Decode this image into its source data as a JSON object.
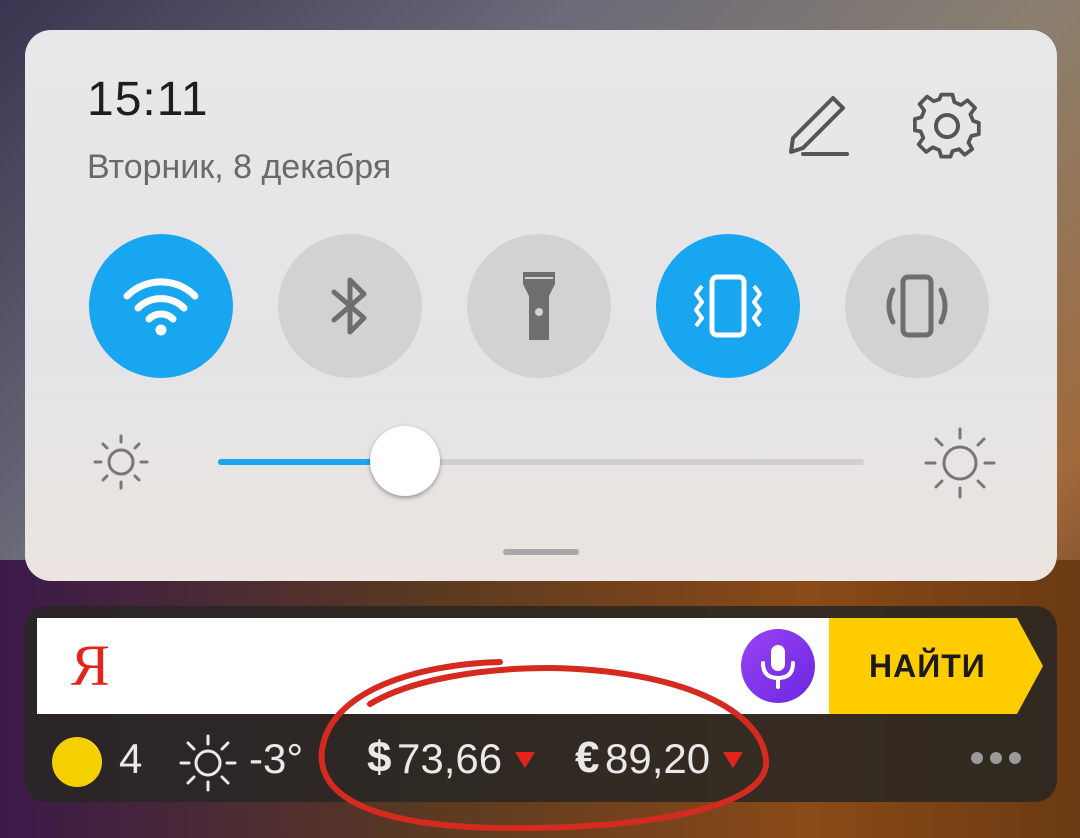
{
  "quick_settings": {
    "time": "15:11",
    "date": "Вторник, 8 декабря",
    "toggles": [
      {
        "icon": "wifi-icon",
        "state": "on"
      },
      {
        "icon": "bluetooth-icon",
        "state": "off"
      },
      {
        "icon": "flashlight-icon",
        "state": "off"
      },
      {
        "icon": "vibrate-icon",
        "state": "on"
      },
      {
        "icon": "auto-rotate-icon",
        "state": "off"
      }
    ],
    "brightness_fraction": 0.29,
    "accent_color": "#18a6f0"
  },
  "yandex_widget": {
    "logo": "Я",
    "search_placeholder": "",
    "find_button": "НАЙТИ",
    "traffic_score": "4",
    "temperature": "-3°",
    "usd_symbol": "$",
    "usd_rate": "73,66",
    "eur_symbol": "€",
    "eur_rate": "89,20",
    "brand_colors": {
      "logo": "#e4231b",
      "button": "#ffcc00",
      "mic": "#8a38f0",
      "down_arrow": "#e4231b"
    }
  }
}
